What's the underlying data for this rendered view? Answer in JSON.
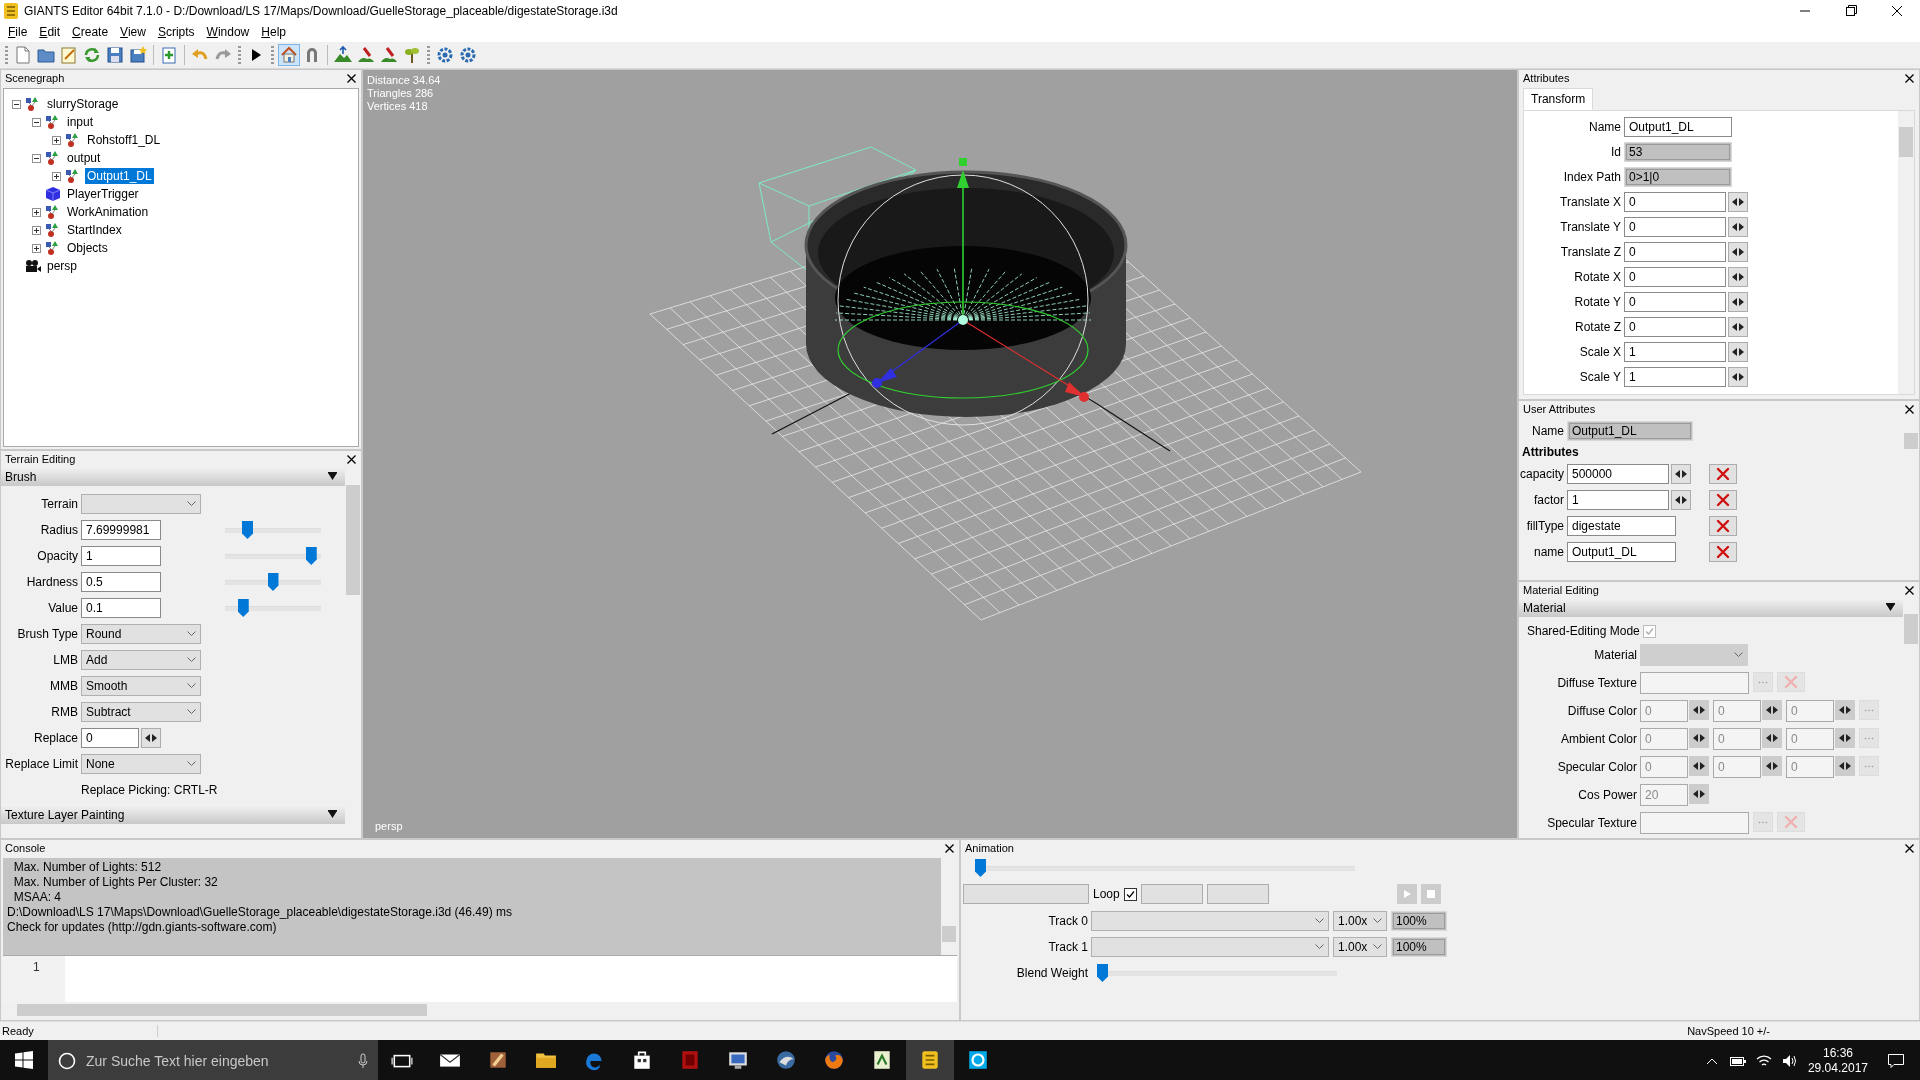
{
  "window": {
    "title": "GIANTS Editor 64bit 7.1.0 - D:/Download/LS 17/Maps/Download/GuelleStorage_placeable/digestateStorage.i3d"
  },
  "menu": [
    "File",
    "Edit",
    "Create",
    "View",
    "Scripts",
    "Window",
    "Help"
  ],
  "toolbar": [
    {
      "kind": "grip"
    },
    {
      "kind": "new",
      "pressed": false
    },
    {
      "kind": "open",
      "pressed": false
    },
    {
      "kind": "edit",
      "pressed": false
    },
    {
      "kind": "refresh",
      "pressed": false
    },
    {
      "kind": "save",
      "pressed": false
    },
    {
      "kind": "save-as",
      "pressed": false
    },
    {
      "kind": "separator"
    },
    {
      "kind": "import",
      "pressed": false
    },
    {
      "kind": "separator"
    },
    {
      "kind": "undo",
      "pressed": false
    },
    {
      "kind": "redo",
      "pressed": false
    },
    {
      "kind": "grip"
    },
    {
      "kind": "play",
      "pressed": false
    },
    {
      "kind": "grip"
    },
    {
      "kind": "home",
      "pressed": true
    },
    {
      "kind": "magnet",
      "pressed": false
    },
    {
      "kind": "separator"
    },
    {
      "kind": "terrain",
      "pressed": false
    },
    {
      "kind": "paint",
      "pressed": false
    },
    {
      "kind": "paint",
      "pressed": false
    },
    {
      "kind": "plant",
      "pressed": false
    },
    {
      "kind": "grip"
    },
    {
      "kind": "gear",
      "pressed": false
    },
    {
      "kind": "gear",
      "pressed": false
    }
  ],
  "scenegraph": {
    "title": "Scenegraph",
    "nodes": [
      {
        "label": "slurryStorage",
        "kind": "transform",
        "expanded": true,
        "selected": false,
        "children": [
          {
            "label": "input",
            "kind": "transform",
            "expanded": true,
            "selected": false,
            "children": [
              {
                "label": "Rohstoff1_DL",
                "kind": "transform",
                "expanded": false,
                "selected": false
              }
            ]
          },
          {
            "label": "output",
            "kind": "transform",
            "expanded": true,
            "selected": false,
            "children": [
              {
                "label": "Output1_DL",
                "kind": "transform",
                "expanded": false,
                "selected": true
              }
            ]
          },
          {
            "label": "PlayerTrigger",
            "kind": "shape",
            "selected": false
          },
          {
            "label": "WorkAnimation",
            "kind": "transform",
            "expanded": false,
            "selected": false
          },
          {
            "label": "StartIndex",
            "kind": "transform",
            "expanded": false,
            "selected": false
          },
          {
            "label": "Objects",
            "kind": "transform",
            "expanded": false,
            "selected": false
          }
        ]
      },
      {
        "label": "persp",
        "kind": "camera",
        "selected": false
      }
    ]
  },
  "terrain_editing": {
    "title": "Terrain Editing",
    "section": "Brush",
    "fields": [
      {
        "kind": "dropdown",
        "label": "Terrain"
      },
      {
        "kind": "slider",
        "label": "Radius",
        "value": "7.69999981",
        "level": 0.2
      },
      {
        "kind": "slider",
        "label": "Opacity",
        "value": "1",
        "level": 0.95
      },
      {
        "kind": "slider",
        "label": "Hardness",
        "value": "0.5",
        "level": 0.5
      },
      {
        "kind": "slider",
        "label": "Value",
        "value": "0.1",
        "level": 0.15
      },
      {
        "kind": "dropdown",
        "label": "Brush Type",
        "value": "Round"
      },
      {
        "kind": "dropdown",
        "label": "LMB",
        "value": "Add"
      },
      {
        "kind": "dropdown",
        "label": "MMB",
        "value": "Smooth"
      },
      {
        "kind": "dropdown",
        "label": "RMB",
        "value": "Subtract"
      },
      {
        "kind": "spin",
        "label": "Replace",
        "value": "0"
      },
      {
        "kind": "dropdown",
        "label": "Replace Limit",
        "value": "None"
      },
      {
        "kind": "note",
        "value": "Replace Picking: CRTL-R"
      }
    ],
    "next_section": "Texture Layer Painting"
  },
  "viewport": {
    "stats": [
      "Distance 34.64",
      "Triangles 286",
      "Vertices 418"
    ],
    "camera": "persp"
  },
  "attributes": {
    "title": "Attributes",
    "tabs": [
      {
        "label": "Transform",
        "selected": true
      }
    ],
    "fields": [
      {
        "kind": "text",
        "label": "Name",
        "value": "Output1_DL"
      },
      {
        "kind": "readonly",
        "label": "Id",
        "value": "53"
      },
      {
        "kind": "readonly",
        "label": "Index Path",
        "value": "0>1|0"
      },
      {
        "kind": "spin",
        "label": "Translate X",
        "value": "0"
      },
      {
        "kind": "spin",
        "label": "Translate Y",
        "value": "0"
      },
      {
        "kind": "spin",
        "label": "Translate Z",
        "value": "0"
      },
      {
        "kind": "spin",
        "label": "Rotate X",
        "value": "0"
      },
      {
        "kind": "spin",
        "label": "Rotate Y",
        "value": "0"
      },
      {
        "kind": "spin",
        "label": "Rotate Z",
        "value": "0"
      },
      {
        "kind": "spin",
        "label": "Scale X",
        "value": "1"
      },
      {
        "kind": "spin",
        "label": "Scale Y",
        "value": "1"
      }
    ]
  },
  "user_attributes": {
    "title": "User Attributes",
    "name_label": "Name",
    "name_value": "Output1_DL",
    "heading": "Attributes",
    "rows": [
      {
        "kind": "spin",
        "label": "capacity",
        "value": "500000"
      },
      {
        "kind": "spin",
        "label": "factor",
        "value": "1"
      },
      {
        "kind": "text",
        "label": "fillType",
        "value": "digestate"
      },
      {
        "kind": "text",
        "label": "name",
        "value": "Output1_DL"
      }
    ]
  },
  "material_editing": {
    "title": "Material Editing",
    "section": "Material",
    "disabled": true,
    "shared": {
      "label": "Shared-Editing Mode",
      "checked": true
    },
    "fields": [
      {
        "kind": "dropdown",
        "label": "Material"
      },
      {
        "kind": "texture",
        "label": "Diffuse Texture"
      },
      {
        "kind": "color",
        "label": "Diffuse Color",
        "values": [
          "0",
          "0",
          "0"
        ]
      },
      {
        "kind": "color",
        "label": "Ambient Color",
        "values": [
          "0",
          "0",
          "0"
        ]
      },
      {
        "kind": "color",
        "label": "Specular Color",
        "values": [
          "0",
          "0",
          "0"
        ]
      },
      {
        "kind": "spin",
        "label": "Cos Power",
        "value": "20"
      },
      {
        "kind": "texture",
        "label": "Specular Texture"
      }
    ]
  },
  "console": {
    "title": "Console",
    "lines": [
      "  Max. Number of Lights: 512",
      "  Max. Number of Lights Per Cluster: 32",
      "  MSAA: 4",
      "D:\\Download\\LS 17\\Maps\\Download\\GuelleStorage_placeable\\digestateStorage.i3d (46.49) ms",
      "Check for updates (http://gdn.giants-software.com)"
    ],
    "line_numbers": [
      "1"
    ]
  },
  "animation": {
    "title": "Animation",
    "timeline": {
      "level": 0
    },
    "loop": {
      "label": "Loop",
      "checked": true
    },
    "tracks": [
      {
        "label": "Track 0",
        "speed": "1.00x",
        "weight": "100%"
      },
      {
        "label": "Track 1",
        "speed": "1.00x",
        "weight": "100%"
      }
    ],
    "blend": {
      "label": "Blend Weight",
      "level": 0
    }
  },
  "status_bar": {
    "left": "Ready",
    "right": "NavSpeed 10 +/-"
  },
  "taskbar": {
    "search_placeholder": "Zur Suche Text hier eingeben",
    "apps": [
      {
        "kind": "task-view",
        "active": false
      },
      {
        "kind": "mail",
        "active": false
      },
      {
        "kind": "hammer",
        "active": false
      },
      {
        "kind": "folder",
        "active": false
      },
      {
        "kind": "edge",
        "active": false
      },
      {
        "kind": "store",
        "active": false
      },
      {
        "kind": "red-app",
        "active": false
      },
      {
        "kind": "monitor",
        "active": false
      },
      {
        "kind": "bird",
        "active": false
      },
      {
        "kind": "fox",
        "active": false
      },
      {
        "kind": "sheet",
        "active": false
      },
      {
        "kind": "giants",
        "active": true
      },
      {
        "kind": "skype",
        "active": false
      }
    ],
    "time": "16:36",
    "date": "29.04.2017"
  }
}
